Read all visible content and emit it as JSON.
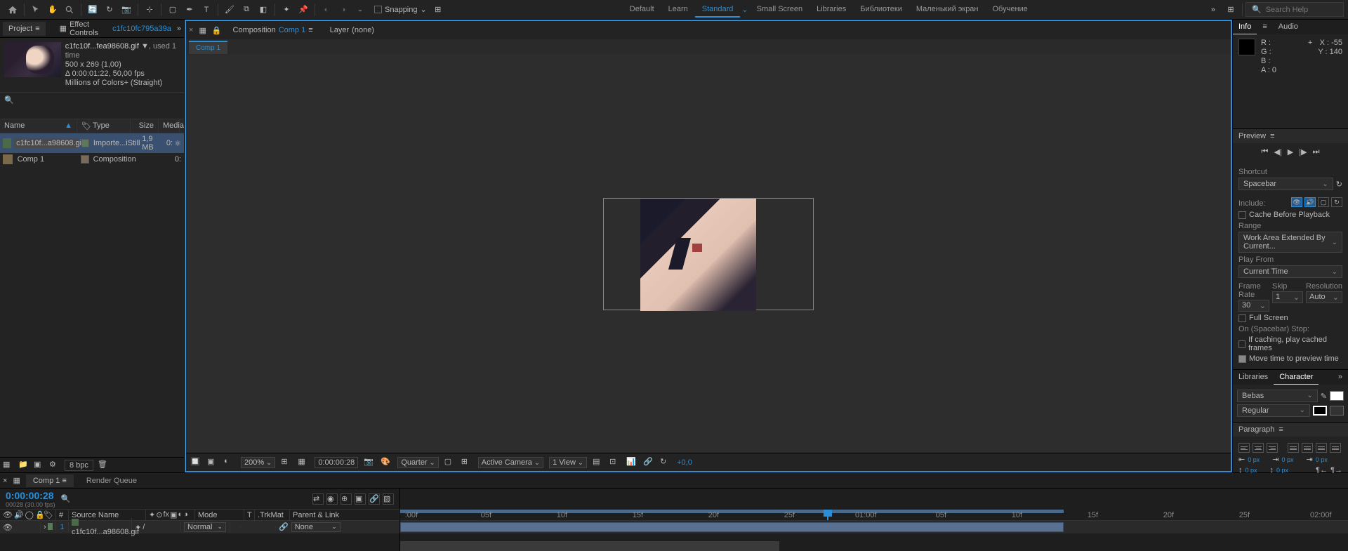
{
  "toolbar": {
    "snapping": "Snapping",
    "workspaces": [
      "Default",
      "Learn",
      "Standard",
      "Small Screen",
      "Libraries",
      "Библиотеки",
      "Маленький экран",
      "Обучение"
    ],
    "active_ws": 2,
    "search_placeholder": "Search Help"
  },
  "project": {
    "tab": "Project",
    "effect_controls": "Effect Controls",
    "ec_ref": "c1fc10fc795a39a",
    "asset": {
      "name": "c1fc10f...fea98608.gif",
      "used": ", used 1 time",
      "dims": "500 x 269 (1,00)",
      "dur": "Δ 0:00:01:22, 50,00 fps",
      "colors": "Millions of Colors+ (Straight)"
    },
    "cols": {
      "name": "Name",
      "tag": "",
      "type": "Type",
      "size": "Size",
      "media": "Media"
    },
    "items": [
      {
        "name": "c1fc10f...a98608.gif",
        "type": "Importe...iStill",
        "size": "1,9 MB",
        "media": "0:",
        "sel": true
      },
      {
        "name": "Comp 1",
        "type": "Composition",
        "size": "",
        "media": "0:",
        "comp": true
      }
    ],
    "bpc": "8 bpc"
  },
  "comp": {
    "tab_label": "Composition",
    "tab_comp": "Comp 1",
    "layer_label": "Layer",
    "layer_none": "(none)",
    "subtab": "Comp 1"
  },
  "viewer": {
    "zoom": "200%",
    "timecode": "0:00:00:28",
    "res": "Quarter",
    "camera": "Active Camera",
    "view": "1 View",
    "exposure": "+0,0"
  },
  "info": {
    "tab": "Info",
    "audio": "Audio",
    "R": "R :",
    "G": "G :",
    "B": "B :",
    "A": "A :  0",
    "X": "X : -55",
    "Y": "Y :  140"
  },
  "preview": {
    "tab": "Preview",
    "shortcut_label": "Shortcut",
    "shortcut": "Spacebar",
    "include": "Include:",
    "cache": "Cache Before Playback",
    "range_label": "Range",
    "range": "Work Area Extended By Current...",
    "playfrom_label": "Play From",
    "playfrom": "Current Time",
    "framerate_label": "Frame Rate",
    "framerate": "30",
    "skip_label": "Skip",
    "skip": "1",
    "resolution_label": "Resolution",
    "resolution": "Auto",
    "fullscreen": "Full Screen",
    "onstop": "On (Spacebar) Stop:",
    "ifcaching": "If caching, play cached frames",
    "movetime": "Move time to preview time"
  },
  "char": {
    "libraries": "Libraries",
    "tab": "Character",
    "font": "Bebas",
    "style": "Regular"
  },
  "para": {
    "tab": "Paragraph",
    "indent": "0 px"
  },
  "timeline": {
    "comp_tab": "Comp 1",
    "render_queue": "Render Queue",
    "timecode": "0:00:00:28",
    "frames": "00028 (30.00 fps)",
    "cols": {
      "src": "Source Name",
      "mode": "Mode",
      "t": "T",
      "trk": ".TrkMat",
      "parent": "Parent & Link"
    },
    "layer": {
      "num": "1",
      "name": "c1fc10f...a98608.gif",
      "mode": "Normal",
      "parent": "None"
    },
    "ticks": [
      ":00f",
      "05f",
      "10f",
      "15f",
      "20f",
      "25f",
      "01:00f",
      "05f",
      "10f",
      "15f",
      "20f",
      "25f",
      "02:00f"
    ]
  }
}
